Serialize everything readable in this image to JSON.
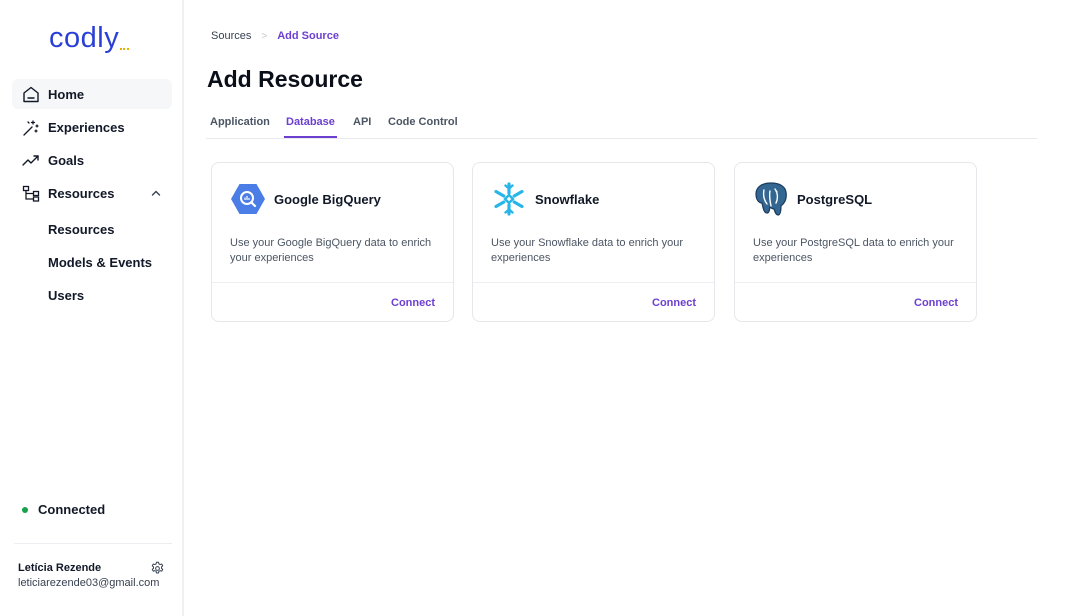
{
  "app": {
    "logo_text": "codly"
  },
  "sidebar": {
    "items": [
      {
        "label": "Home",
        "icon": "home-icon"
      },
      {
        "label": "Experiences",
        "icon": "magic-wand-icon"
      },
      {
        "label": "Goals",
        "icon": "trending-up-icon"
      },
      {
        "label": "Resources",
        "icon": "hierarchy-icon"
      }
    ],
    "sub_items": [
      "Resources",
      "Models & Events",
      "Users"
    ],
    "status": "Connected",
    "user": {
      "name": "Letícia Rezende",
      "email": "leticiarezende03@gmail.com"
    }
  },
  "breadcrumb": {
    "parent": "Sources",
    "current": "Add Source"
  },
  "page": {
    "title": "Add Resource"
  },
  "tabs": [
    "Application",
    "Database",
    "API",
    "Code Control"
  ],
  "cards": [
    {
      "title": "Google BigQuery",
      "description": "Use your Google BigQuery data to enrich your experiences",
      "button": "Connect",
      "icon": "bigquery-logo"
    },
    {
      "title": "Snowflake",
      "description": "Use your Snowflake data to enrich your experiences",
      "button": "Connect",
      "icon": "snowflake-logo"
    },
    {
      "title": "PostgreSQL",
      "description": "Use your PostgreSQL data to enrich your experiences",
      "button": "Connect",
      "icon": "postgresql-logo"
    }
  ],
  "colors": {
    "brand": "#2a3fd6",
    "accent": "#6d3fd0",
    "status": "#16a34a"
  }
}
